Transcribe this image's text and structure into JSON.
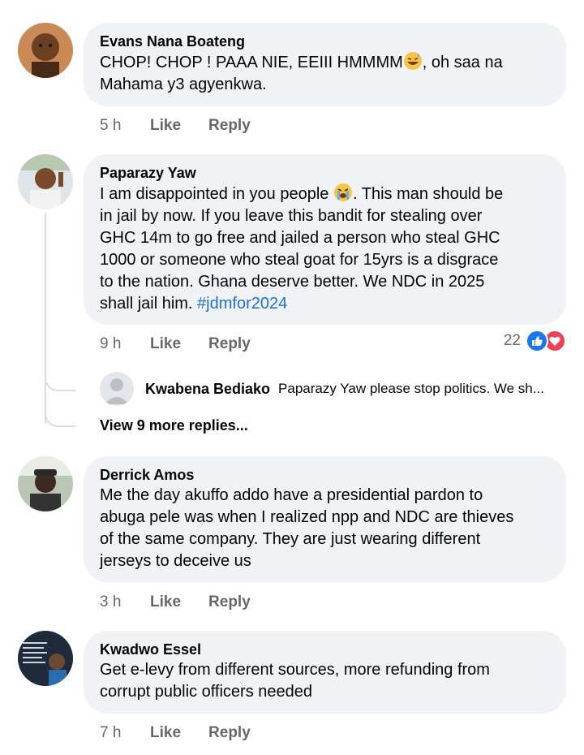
{
  "comments": [
    {
      "author": "Evans Nana Boateng",
      "text_before_emoji": "CHOP! CHOP ! PAAA NIE, EEIII HMMMM",
      "emoji": "grinning-sweat-emoji",
      "text_after_emoji": ", oh saa na\nMahama y3 agyenkwa.",
      "time": "5 h",
      "like_label": "Like",
      "reply_label": "Reply"
    },
    {
      "author": "Paparazy Yaw",
      "text_before_emoji": "I am disappointed in you people ",
      "emoji": "loudly-crying-emoji",
      "text_after_emoji": ". This man should be\nin jail by now. If  you leave this bandit for stealing over\nGHC 14m to go free and jailed  a person who steal GHC\n1000 or someone who steal goat for 15yrs is a disgrace\nto the nation. Ghana deserve better. We NDC in 2025\nshall jail him. ",
      "hashtag": "#jdmfor2024",
      "time": "9 h",
      "like_label": "Like",
      "reply_label": "Reply",
      "reaction_count": "22",
      "reactions": [
        "like-icon",
        "love-icon"
      ],
      "reply_preview": {
        "author": "Kwabena Bediako",
        "snippet": "Paparazy Yaw please stop politics. We sh..."
      },
      "view_more": "View 9 more replies..."
    },
    {
      "author": "Derrick Amos",
      "text": "Me the day akuffo addo have a presidential pardon to\nabuga pele was when I realized npp and NDC are thieves\nof the same company. They are just wearing different\njerseys to deceive us",
      "time": "3 h",
      "like_label": "Like",
      "reply_label": "Reply"
    },
    {
      "author": "Kwadwo Essel",
      "text": "Get e-levy from different sources, more refunding from\ncorrupt public officers needed",
      "time": "7 h",
      "like_label": "Like",
      "reply_label": "Reply"
    }
  ],
  "colors": {
    "bubble": "#f0f2f5",
    "secondary_text": "#65676b",
    "hashtag": "#216fdb",
    "like_blue": "#1877f2",
    "love_red": "#f33e58"
  }
}
